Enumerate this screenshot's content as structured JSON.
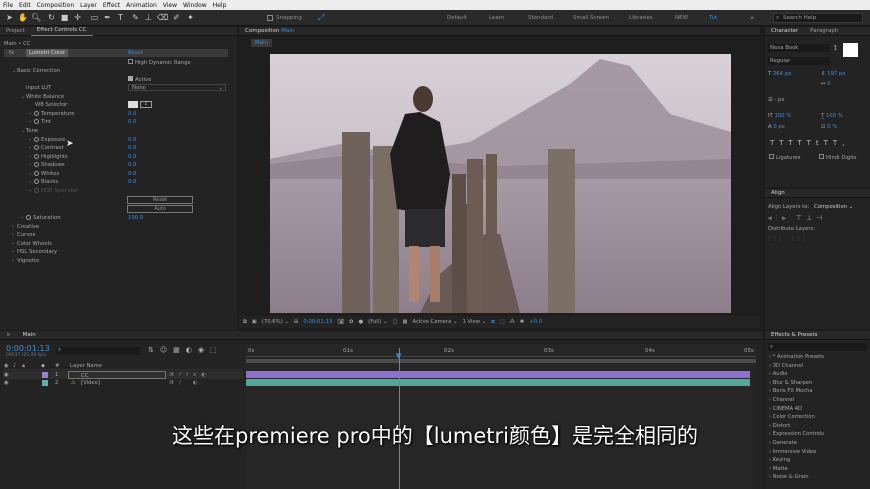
{
  "menu": [
    "File",
    "Edit",
    "Composition",
    "Layer",
    "Effect",
    "Animation",
    "View",
    "Window",
    "Help"
  ],
  "toolbar": {
    "snapping": "Snapping",
    "workspaces": [
      "Default",
      "Learn",
      "Standard",
      "Small Screen",
      "Libraries",
      "NEW",
      "Tut"
    ],
    "active_workspace": "Tut",
    "search_placeholder": "Search Help"
  },
  "left_panel": {
    "tabs": [
      "Project",
      "Effect Controls CC"
    ],
    "breadcrumb": "Main • CC",
    "fx_label": "fx",
    "effect_name": "Lumetri Color",
    "reset": "Reset",
    "hdr": "High Dynamic Range",
    "basic_correction": "Basic Correction",
    "active": "Active",
    "input_lut": "Input LUT",
    "input_lut_value": "None",
    "white_balance": "White Balance",
    "wb_selector": "WB Selector",
    "temperature": "Temperature",
    "temperature_value": "0.0",
    "tint": "Tint",
    "tint_value": "0.0",
    "tone": "Tone",
    "exposure": "Exposure",
    "exposure_value": "0.0",
    "contrast": "Contrast",
    "contrast_value": "0.0",
    "highlights": "Highlights",
    "highlights_value": "0.0",
    "shadows": "Shadows",
    "shadows_value": "0.0",
    "whites": "Whites",
    "whites_value": "0.0",
    "blacks": "Blacks",
    "blacks_value": "0.0",
    "hdr_specular": "HDR Specular",
    "reset_btn": "Reset",
    "auto_btn": "Auto",
    "saturation": "Saturation",
    "saturation_value": "100.0",
    "sections": [
      "Creative",
      "Curves",
      "Color Wheels",
      "HSL Secondary",
      "Vignette"
    ]
  },
  "viewer": {
    "tab": "Composition Main",
    "tab_prefix": "Composition",
    "tab_name": "Main",
    "sub_tab": "Main",
    "zoom": "(70.6%)",
    "timecode": "0;00;01;13",
    "resolution": "(Full)",
    "camera": "Active Camera",
    "views": "1 View",
    "exposure": "+0.0"
  },
  "character": {
    "tabs": [
      "Character",
      "Paragraph"
    ],
    "font": "Nexa Book",
    "style": "Regular",
    "size": "264 px",
    "leading": "197 px",
    "tracking": "0",
    "stroke": "- px",
    "vscale": "100 %",
    "hscale": "100 %",
    "baseline": "0 px",
    "tsume": "0 %",
    "ligatures": "Ligatures",
    "hindi": "Hindi Digits",
    "text_styles": [
      "T",
      "T",
      "TT",
      "Tt",
      "T",
      "T,"
    ]
  },
  "align": {
    "title": "Align",
    "align_to_label": "Align Layers to:",
    "align_to_value": "Composition",
    "distribute": "Distribute Layers:"
  },
  "effects": {
    "title": "Effects & Presets",
    "items": [
      "* Animation Presets",
      "3D Channel",
      "Audio",
      "Blur & Sharpen",
      "Boris FX Mocha",
      "Channel",
      "CINEMA 4D",
      "Color Correction",
      "Distort",
      "Expression Controls",
      "Generate",
      "Immersive Video",
      "Keying",
      "Matte",
      "Noise & Grain"
    ]
  },
  "timeline": {
    "tab": "Main",
    "timecode": "0:00:01:13",
    "fps": "00037 (25.00 fps)",
    "col_header": "Layer Name",
    "layers": [
      {
        "num": "1",
        "name": "CC"
      },
      {
        "num": "2",
        "name": "[Video]"
      }
    ],
    "ruler": [
      "0s",
      "01s",
      "02s",
      "03s",
      "04s",
      "05s"
    ]
  },
  "subtitle": "这些在premiere pro中的【lumetri颜色】是完全相同的",
  "colors": {
    "accent": "#3b8fe0",
    "adjustment_bar": "#8b6fd1",
    "video_bar": "#4fa89a",
    "playhead": "#3b8fe0"
  }
}
